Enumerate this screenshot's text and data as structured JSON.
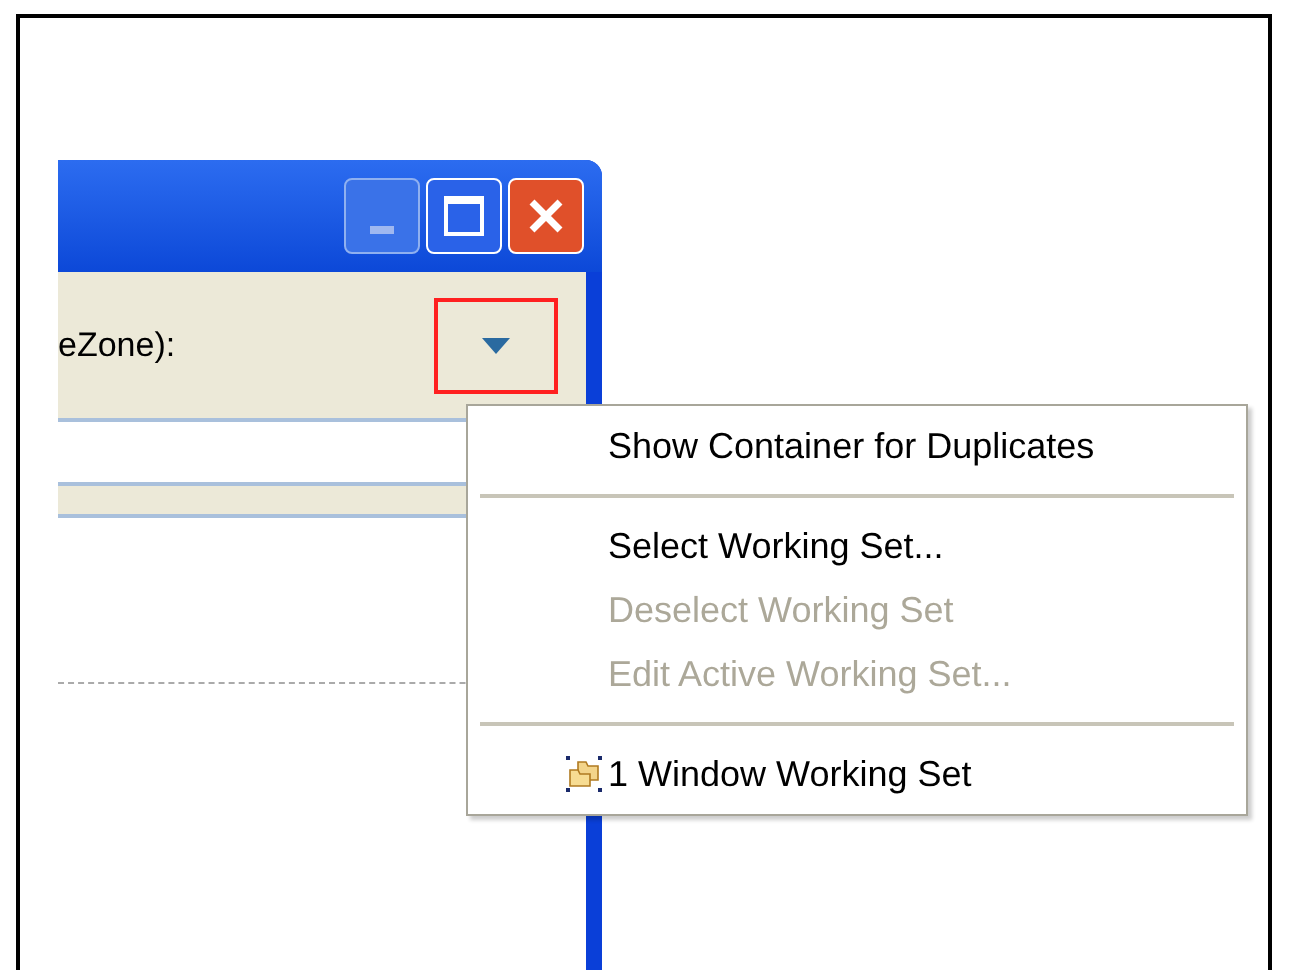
{
  "window": {
    "label": "eZone):"
  },
  "menu": {
    "items": [
      {
        "kind": "item",
        "label": "Show Container for Duplicates",
        "disabled": false
      },
      {
        "kind": "separator"
      },
      {
        "kind": "item",
        "label": "Select Working Set...",
        "disabled": false
      },
      {
        "kind": "item",
        "label": "Deselect Working Set",
        "disabled": true
      },
      {
        "kind": "item",
        "label": "Edit Active Working Set...",
        "disabled": true
      },
      {
        "kind": "separator"
      },
      {
        "kind": "working-set",
        "label": "1 Window Working Set",
        "disabled": false
      }
    ]
  }
}
